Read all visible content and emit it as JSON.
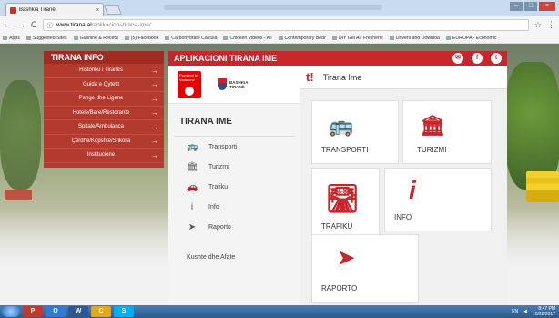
{
  "browser": {
    "tab_title": "Bashkia Tiranë",
    "tab_close": "×",
    "url_domain": "www.tirana.al",
    "url_path": "/aplikacioni-tirana-ime/",
    "nav_back": "←",
    "nav_forward": "→",
    "nav_reload": "C",
    "bookmarks": [
      "Apps",
      "Suggested Sites",
      "Gushine & Receta",
      "(5) Facebook",
      "Carbohydrate Calcula",
      "Chicken Videos - All",
      "Contemporary Bedr",
      "DIY Gel Air Freshene",
      "Drivers and Downloa",
      "EUROPA - Economic"
    ]
  },
  "tirana_info": {
    "title": "TIRANA INFO",
    "items": [
      "Historiku i Tiranës",
      "Guida e Qytetit",
      "Pange dhe Ligene",
      "Hotele/Bare/Restorante",
      "Spitale/Ambulanca",
      "Çerdhe/Kopshte/Shkolla",
      "Institucione"
    ],
    "arrow": "→"
  },
  "app": {
    "title": "APLIKACIONI TIRANA IME",
    "header_icons": [
      "email-icon",
      "facebook-icon",
      "twitter-icon"
    ],
    "header_icon_glyphs": [
      "✉",
      "f",
      "t"
    ],
    "brand_powered": "Powered by Vodafone",
    "brand_bashkia": "BASHKIA",
    "brand_tirane": "TIRANË",
    "sidebar_title": "TIRANA IME",
    "sidebar_items": [
      {
        "label": "Transporti",
        "icon": "🚌"
      },
      {
        "label": "Turizmi",
        "icon": "🏛"
      },
      {
        "label": "Trafiku",
        "icon": "🚗"
      },
      {
        "label": "Info",
        "icon": "i"
      },
      {
        "label": "Raporto",
        "icon": "➤"
      }
    ],
    "sidebar_footer": "Kushte dhe Afate",
    "content_logo": "t!",
    "content_title": "Tirana Ime",
    "tiles": [
      {
        "label": "TRANSPORTI",
        "icon": "🚌"
      },
      {
        "label": "TURIZMI",
        "icon": "🏛"
      },
      {
        "label": "TRAFIKU",
        "icon": "🛣"
      },
      {
        "label": "INFO",
        "icon": "i"
      },
      {
        "label": "RAPORTO",
        "icon": "➤"
      }
    ]
  },
  "taskbar": {
    "apps": [
      "P",
      "O",
      "W",
      "C",
      "S"
    ],
    "tray_lang": "EN",
    "time": "8:47 PM",
    "date": "10/28/2017"
  }
}
